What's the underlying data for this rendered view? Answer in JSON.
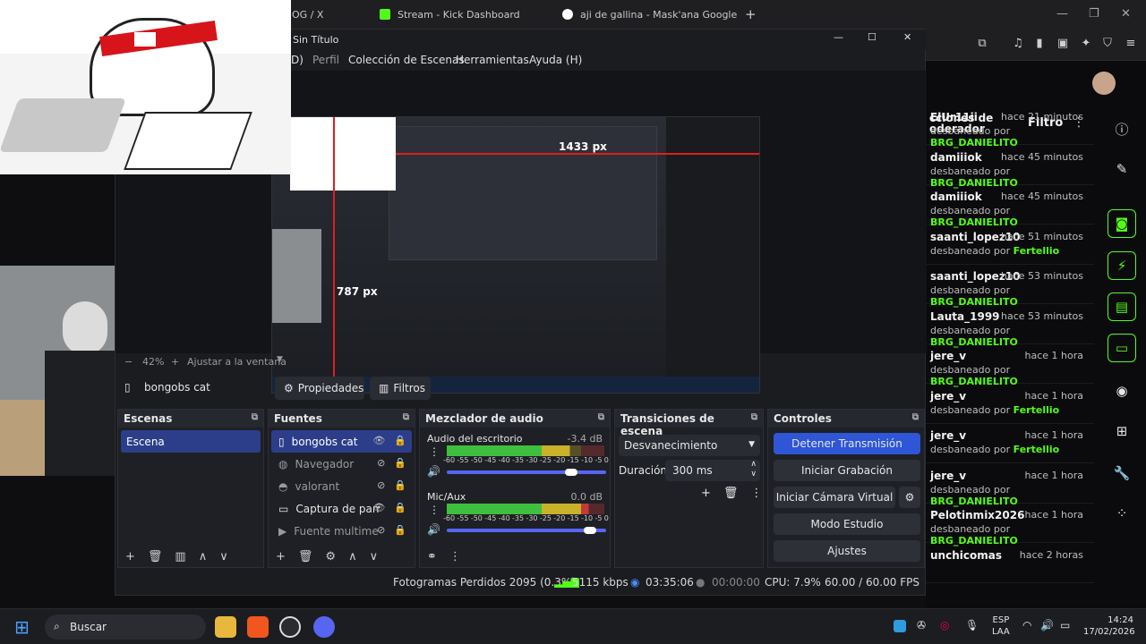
{
  "browser": {
    "tabs": [
      {
        "label": "OG / X"
      },
      {
        "label": "Stream - Kick Dashboard"
      },
      {
        "label": "aji de gallina - Mask'ana Google"
      }
    ],
    "new_tab": "+"
  },
  "kick": {
    "panel_title_1": "cciones de",
    "panel_title_2": "oderador",
    "filter_label": "Filtro",
    "more": "⋮",
    "entries": [
      {
        "user": "ElUr11ii",
        "time": "hace 21 minutos",
        "action": "desbaneado por",
        "by": "BRG_DANIELITO"
      },
      {
        "user": "damiiiok",
        "time": "hace 45 minutos",
        "action": "desbaneado por",
        "by": "BRG_DANIELITO"
      },
      {
        "user": "damiiiok",
        "time": "hace 45 minutos",
        "action": "desbaneado por",
        "by": "BRG_DANIELITO"
      },
      {
        "user": "saanti_lopez10",
        "time": "hace 51 minutos",
        "action": "desbaneado por",
        "by": "Fertellio"
      },
      {
        "user": "saanti_lopez10",
        "time": "hace 53 minutos",
        "action": "desbaneado por",
        "by": "BRG_DANIELITO"
      },
      {
        "user": "Lauta_1999",
        "time": "hace 53 minutos",
        "action": "desbaneado por",
        "by": "BRG_DANIELITO"
      },
      {
        "user": "jere_v",
        "time": "hace 1 hora",
        "action": "desbaneado por",
        "by": "BRG_DANIELITO"
      },
      {
        "user": "jere_v",
        "time": "hace 1 hora",
        "action": "desbaneado por",
        "by": "Fertellio"
      },
      {
        "user": "jere_v",
        "time": "hace 1 hora",
        "action": "desbaneado por",
        "by": "Fertellio"
      },
      {
        "user": "jere_v",
        "time": "hace 1 hora",
        "action": "desbaneado por",
        "by": "BRG_DANIELITO"
      },
      {
        "user": "Pelotinmix2026",
        "time": "hace 1 hora",
        "action": "desbaneado por",
        "by": "BRG_DANIELITO"
      },
      {
        "user": "unchicomas",
        "time": "hace 2 horas",
        "action": "",
        "by": ""
      }
    ]
  },
  "obs": {
    "title": "Sin Título",
    "menu": [
      "D)",
      "Perfil",
      "Colección de Escenas",
      "Herramientas",
      "Ayuda (H)"
    ],
    "preview": {
      "dim_h": "1433 px",
      "dim_v": "787 px"
    },
    "zoom": {
      "minus": "−",
      "value": "42%",
      "plus": "+",
      "fit": "Ajustar a la ventana"
    },
    "selected_source": "bongobs cat",
    "properties_label": "Propiedades",
    "filters_label": "Filtros",
    "docks": {
      "scenes_title": "Escenas",
      "scenes": [
        "Escena"
      ],
      "sources_title": "Fuentes",
      "sources": [
        "bongobs cat",
        "Navegador",
        "valorant",
        "Captura de pan",
        "Fuente multime"
      ],
      "mixer_title": "Mezclador de audio",
      "mixer": [
        {
          "name": "Audio del escritorio",
          "db": "-3.4 dB",
          "level": 0.78
        },
        {
          "name": "Mic/Aux",
          "db": "0.0 dB",
          "level": 0.9
        }
      ],
      "meter_scale": [
        "-60",
        "-55",
        "-50",
        "-45",
        "-40",
        "-35",
        "-30",
        "-25",
        "-20",
        "-15",
        "-10",
        "-5",
        "0"
      ],
      "transitions_title": "Transiciones de escena",
      "transition_value": "Desvanecimiento",
      "duration_label": "Duración",
      "duration_value": "300 ms",
      "controls_title": "Controles",
      "controls": [
        "Detener Transmisión",
        "Iniciar Grabación",
        "Iniciar Cámara Virtual",
        "Modo Estudio",
        "Ajustes"
      ]
    },
    "status": {
      "dropped": "Fotogramas Perdidos 2095 (0.3%)",
      "bitrate": "5115 kbps",
      "stream_time": "03:35:06",
      "rec_time": "00:00:00",
      "cpu": "CPU: 7.9%",
      "fps": "60.00 / 60.00 FPS"
    }
  },
  "taskbar": {
    "search": "Buscar",
    "lang1": "ESP",
    "lang2": "LAA",
    "time": "14:24",
    "date": "17/02/2026"
  },
  "colors": {
    "accent_green": "#53fc18",
    "obs_blue": "#2e56d6"
  }
}
